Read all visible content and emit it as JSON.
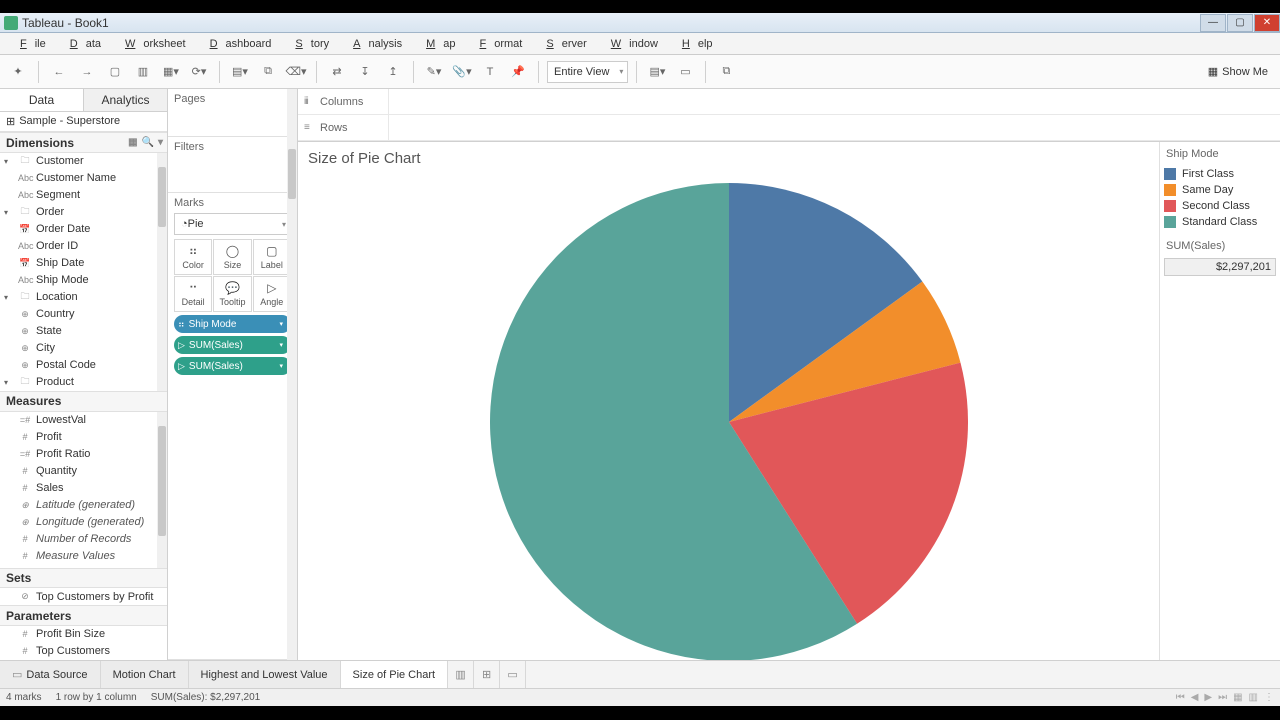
{
  "window": {
    "title": "Tableau - Book1"
  },
  "menu": [
    "File",
    "Data",
    "Worksheet",
    "Dashboard",
    "Story",
    "Analysis",
    "Map",
    "Format",
    "Server",
    "Window",
    "Help"
  ],
  "toolbar": {
    "fit": "Entire View",
    "showme": "Show Me"
  },
  "sidepanel": {
    "tabs": {
      "data": "Data",
      "analytics": "Analytics"
    },
    "datasource": "Sample - Superstore",
    "dimensions_label": "Dimensions",
    "measures_label": "Measures",
    "sets_label": "Sets",
    "params_label": "Parameters",
    "dim_groups": [
      {
        "name": "Customer",
        "items": [
          {
            "ico": "Abc",
            "name": "Customer Name"
          },
          {
            "ico": "Abc",
            "name": "Segment"
          }
        ]
      },
      {
        "name": "Order",
        "items": [
          {
            "ico": "📅",
            "name": "Order Date"
          },
          {
            "ico": "Abc",
            "name": "Order ID"
          },
          {
            "ico": "📅",
            "name": "Ship Date"
          },
          {
            "ico": "Abc",
            "name": "Ship Mode"
          }
        ]
      },
      {
        "name": "Location",
        "items": [
          {
            "ico": "⊕",
            "name": "Country"
          },
          {
            "ico": "⊕",
            "name": "State"
          },
          {
            "ico": "⊕",
            "name": "City"
          },
          {
            "ico": "⊕",
            "name": "Postal Code"
          }
        ]
      },
      {
        "name": "Product",
        "items": []
      }
    ],
    "measures": [
      {
        "ico": "=#",
        "name": "LowestVal"
      },
      {
        "ico": "#",
        "name": "Profit"
      },
      {
        "ico": "=#",
        "name": "Profit Ratio"
      },
      {
        "ico": "#",
        "name": "Quantity"
      },
      {
        "ico": "#",
        "name": "Sales"
      },
      {
        "ico": "⊕",
        "name": "Latitude (generated)",
        "italic": true
      },
      {
        "ico": "⊕",
        "name": "Longitude (generated)",
        "italic": true
      },
      {
        "ico": "#",
        "name": "Number of Records",
        "italic": true
      },
      {
        "ico": "#",
        "name": "Measure Values",
        "italic": true
      }
    ],
    "sets": [
      {
        "ico": "⊘",
        "name": "Top Customers by Profit"
      }
    ],
    "params": [
      {
        "ico": "#",
        "name": "Profit Bin Size"
      },
      {
        "ico": "#",
        "name": "Top Customers"
      }
    ]
  },
  "shelves": {
    "pages": "Pages",
    "filters": "Filters",
    "marks": "Marks",
    "mark_type": "Pie",
    "mark_cells": [
      "Color",
      "Size",
      "Label",
      "Detail",
      "Tooltip",
      "Angle"
    ],
    "pills": [
      {
        "kind": "color",
        "label": "Ship Mode",
        "cls": "blue"
      },
      {
        "kind": "size",
        "label": "SUM(Sales)",
        "cls": "teal"
      },
      {
        "kind": "angle",
        "label": "SUM(Sales)",
        "cls": "teal"
      }
    ],
    "columns": "Columns",
    "rows": "Rows"
  },
  "viz": {
    "title": "Size of Pie Chart",
    "legend_title": "Ship Mode",
    "legend": [
      {
        "label": "First Class",
        "color": "#4e79a7"
      },
      {
        "label": "Same Day",
        "color": "#f28e2b"
      },
      {
        "label": "Second Class",
        "color": "#e15759"
      },
      {
        "label": "Standard Class",
        "color": "#59a49a"
      }
    ],
    "sum_label": "SUM(Sales)",
    "sum_value": "$2,297,201"
  },
  "chart_data": {
    "type": "pie",
    "title": "Size of Pie Chart",
    "series_field": "Ship Mode",
    "value_field": "SUM(Sales)",
    "total": 2297201,
    "slices": [
      {
        "label": "First Class",
        "pct": 15,
        "color": "#4e79a7"
      },
      {
        "label": "Same Day",
        "pct": 6,
        "color": "#f28e2b"
      },
      {
        "label": "Second Class",
        "pct": 20,
        "color": "#e15759"
      },
      {
        "label": "Standard Class",
        "pct": 59,
        "color": "#59a49a"
      }
    ]
  },
  "tabs": {
    "datasource": "Data Source",
    "list": [
      "Motion Chart",
      "Highest and Lowest Value",
      "Size of Pie Chart"
    ],
    "active": 2
  },
  "status": {
    "marks": "4 marks",
    "rows": "1 row by 1 column",
    "sum": "SUM(Sales): $2,297,201"
  }
}
